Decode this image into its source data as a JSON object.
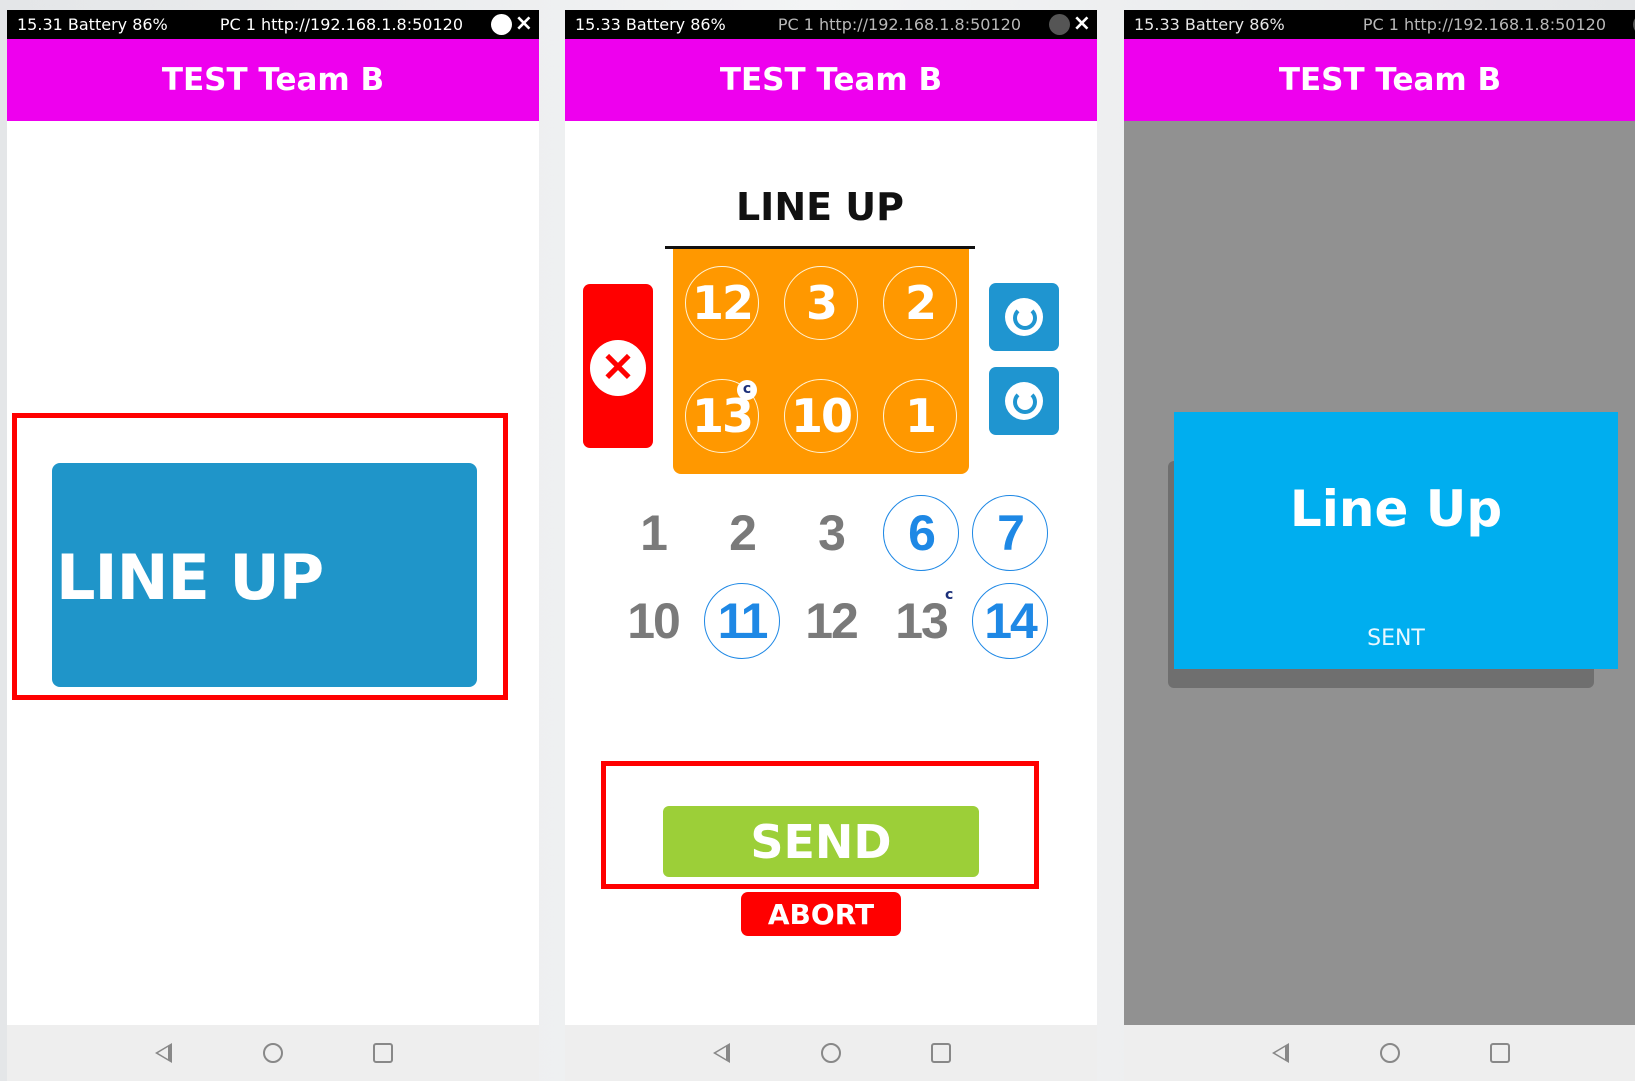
{
  "app_title": "TEST Team B",
  "screens": [
    {
      "status": {
        "time_battery": "15.31 Battery 86%",
        "connection": "PC 1 http://192.168.1.8:50120",
        "close": "×"
      },
      "main_button_label": "LINE UP"
    },
    {
      "status": {
        "time_battery": "15.33 Battery 86%",
        "connection": "PC 1 http://192.168.1.8:50120",
        "close": "×"
      },
      "lineup_title": "LINE UP",
      "court_row_top": [
        "12",
        "3",
        "2"
      ],
      "court_row_bottom": [
        "13",
        "10",
        "1"
      ],
      "captain_mark": "c",
      "roster_row_1": [
        "1",
        "2",
        "3",
        "6",
        "7"
      ],
      "roster_row_2": [
        "10",
        "11",
        "12",
        "13",
        "14"
      ],
      "send_label": "SEND",
      "abort_label": "ABORT",
      "clear_icon": "close-icon",
      "rotate_icons": [
        "rotate-counterclockwise-icon",
        "rotate-clockwise-icon"
      ]
    },
    {
      "status": {
        "time_battery": "15.33 Battery 86%",
        "connection": "PC 1 http://192.168.1.8:50120"
      },
      "dialog_title": "Line Up",
      "dialog_message": "SENT"
    }
  ],
  "colors": {
    "title_bar": "#ee00ee",
    "button_blue": "#1f95c9",
    "court_orange": "#ff9800",
    "send_green": "#9ccf38",
    "abort_red": "#ff0000",
    "dialog_blue": "#00aeef",
    "selected_blue": "#1e88e5"
  }
}
